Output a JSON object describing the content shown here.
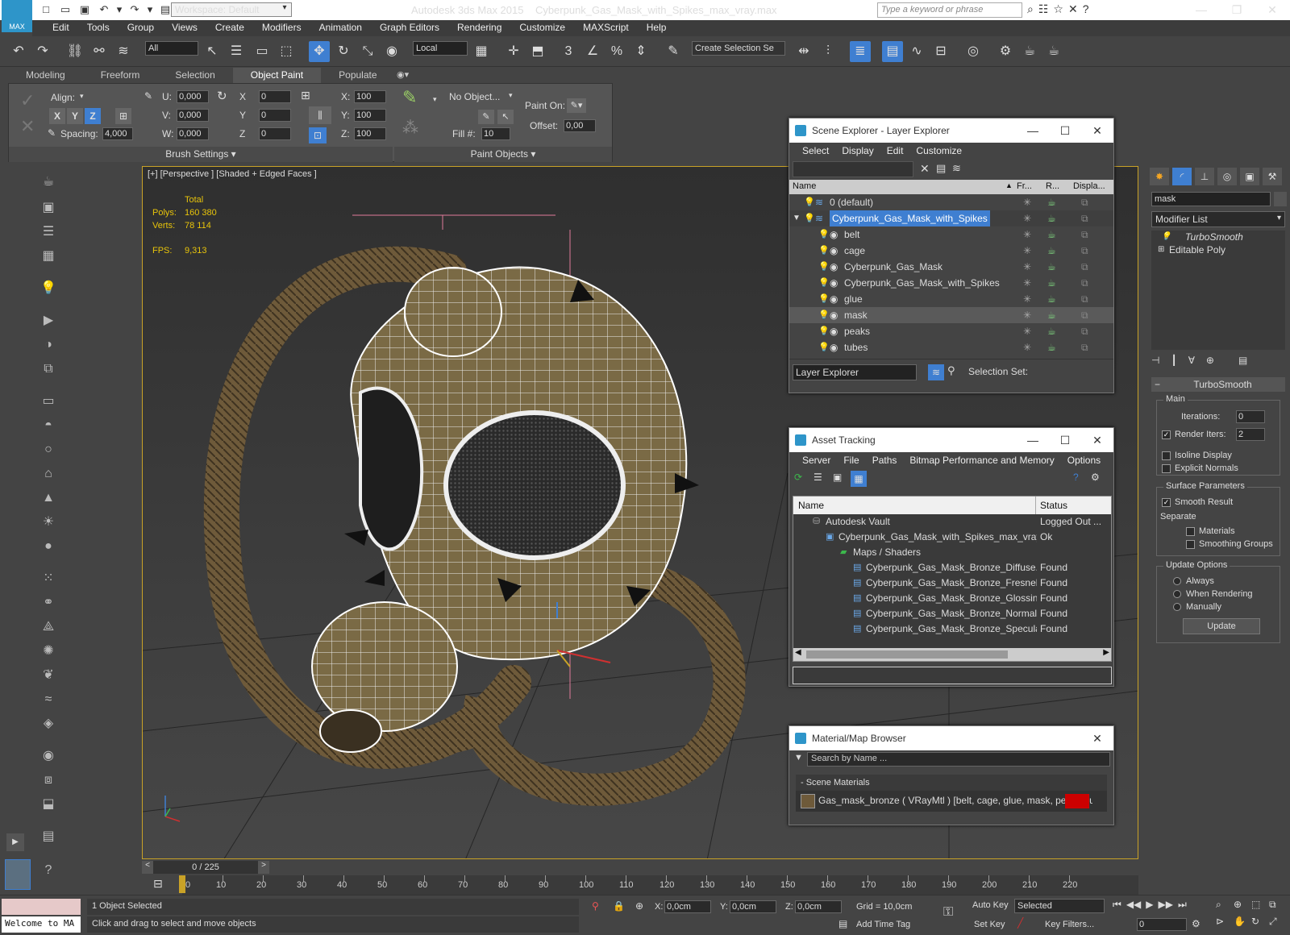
{
  "app": {
    "title": "Autodesk 3ds Max  2015",
    "file": "Cyberpunk_Gas_Mask_with_Spikes_max_vray.max",
    "logo": "MAX",
    "workspace": "Workspace: Default",
    "keyword_placeholder": "Type a keyword or phrase"
  },
  "menu": [
    "Edit",
    "Tools",
    "Group",
    "Views",
    "Create",
    "Modifiers",
    "Animation",
    "Graph Editors",
    "Rendering",
    "Customize",
    "MAXScript",
    "Help"
  ],
  "toolbar": {
    "filter": "All",
    "ref_coord": "Local",
    "selection_set": "Create Selection Se"
  },
  "ribbon": {
    "tabs": [
      "Modeling",
      "Freeform",
      "Selection",
      "Object Paint",
      "Populate"
    ],
    "active_tab": "Object Paint",
    "align": "Align:",
    "axes": [
      "X",
      "Y",
      "Z"
    ],
    "spacing_label": "Spacing:",
    "spacing": "4,000",
    "u_label": "U:",
    "v_label": "V:",
    "w_label": "W:",
    "uvw": [
      "0,000",
      "0,000",
      "0,000"
    ],
    "xyz_labels": [
      "X",
      "Y",
      "Z"
    ],
    "xyz": [
      "0",
      "0",
      "0"
    ],
    "scale_labels": [
      "X:",
      "Y:",
      "Z:"
    ],
    "scale": [
      "100",
      "100",
      "100"
    ],
    "no_object": "No Object...",
    "fill_label": "Fill #:",
    "fill": "10",
    "paint_on": "Paint On:",
    "offset_label": "Offset:",
    "offset": "0,00",
    "brush_settings": "Brush Settings",
    "paint_objects": "Paint Objects"
  },
  "viewport": {
    "label": "[+] [Perspective ] [Shaded + Edged Faces ]",
    "total": "Total",
    "polys_label": "Polys:",
    "polys": "160 380",
    "verts_label": "Verts:",
    "verts": "78 114",
    "fps_label": "FPS:",
    "fps": "9,313"
  },
  "scene_explorer": {
    "title": "Scene Explorer - Layer Explorer",
    "menu": [
      "Select",
      "Display",
      "Edit",
      "Customize"
    ],
    "cols": [
      "Name",
      "Fr...",
      "R...",
      "Displa..."
    ],
    "rows": [
      {
        "name": "0 (default)",
        "level": 0
      },
      {
        "name": "Cyberpunk_Gas_Mask_with_Spikes",
        "level": 0,
        "selected": true
      },
      {
        "name": "belt",
        "level": 1
      },
      {
        "name": "cage",
        "level": 1
      },
      {
        "name": "Cyberpunk_Gas_Mask",
        "level": 1
      },
      {
        "name": "Cyberpunk_Gas_Mask_with_Spikes",
        "level": 1
      },
      {
        "name": "glue",
        "level": 1
      },
      {
        "name": "mask",
        "level": 1,
        "highlight": true
      },
      {
        "name": "peaks",
        "level": 1
      },
      {
        "name": "tubes",
        "level": 1
      }
    ],
    "footer_combo": "Layer Explorer",
    "selection_set": "Selection Set:"
  },
  "asset_tracking": {
    "title": "Asset Tracking",
    "menu": [
      "Server",
      "File",
      "Paths",
      "Bitmap Performance and Memory",
      "Options"
    ],
    "cols": [
      "Name",
      "Status"
    ],
    "rows": [
      {
        "name": "Autodesk Vault",
        "status": "Logged Out ...",
        "level": 0
      },
      {
        "name": "Cyberpunk_Gas_Mask_with_Spikes_max_vray...",
        "status": "Ok",
        "level": 1
      },
      {
        "name": "Maps / Shaders",
        "status": "",
        "level": 2
      },
      {
        "name": "Cyberpunk_Gas_Mask_Bronze_Diffuse....",
        "status": "Found",
        "level": 3
      },
      {
        "name": "Cyberpunk_Gas_Mask_Bronze_Fresnel....",
        "status": "Found",
        "level": 3
      },
      {
        "name": "Cyberpunk_Gas_Mask_Bronze_Glossine....",
        "status": "Found",
        "level": 3
      },
      {
        "name": "Cyberpunk_Gas_Mask_Bronze_Normal....",
        "status": "Found",
        "level": 3
      },
      {
        "name": "Cyberpunk_Gas_Mask_Bronze_Specular...",
        "status": "Found",
        "level": 3
      }
    ]
  },
  "material_browser": {
    "title": "Material/Map Browser",
    "search": "Search by Name ...",
    "section": "- Scene Materials",
    "material": "Gas_mask_bronze  ( VRayMtl )  [belt, cage, glue, mask, peaks, tub..."
  },
  "command_panel": {
    "object_name": "mask",
    "modifier_list": "Modifier List",
    "stack": [
      "TurboSmooth",
      "Editable Poly"
    ],
    "rollout": "TurboSmooth",
    "main": "Main",
    "iterations_label": "Iterations:",
    "iterations": "0",
    "render_iters_label": "Render Iters:",
    "render_iters": "2",
    "isoline": "Isoline Display",
    "explicit": "Explicit Normals",
    "surface": "Surface Parameters",
    "smooth_result": "Smooth Result",
    "separate": "Separate",
    "materials": "Materials",
    "smoothing": "Smoothing Groups",
    "update_options": "Update Options",
    "always": "Always",
    "when_rendering": "When Rendering",
    "manually": "Manually",
    "update_btn": "Update"
  },
  "timeline": {
    "frame": "0 / 225",
    "ticks": [
      "0",
      "10",
      "20",
      "30",
      "40",
      "50",
      "60",
      "70",
      "80",
      "90",
      "100",
      "110",
      "120",
      "130",
      "140",
      "150",
      "160",
      "170",
      "180",
      "190",
      "200",
      "210",
      "220"
    ]
  },
  "status": {
    "welcome": "Welcome to MA",
    "selected": "1 Object Selected",
    "hint": "Click and drag to select and move objects",
    "x_label": "X:",
    "x": "0,0cm",
    "y_label": "Y:",
    "y": "0,0cm",
    "z_label": "Z:",
    "z": "0,0cm",
    "grid": "Grid = 10,0cm",
    "add_time_tag": "Add Time Tag",
    "auto_key": "Auto Key",
    "set_key": "Set Key",
    "key_mode": "Selected",
    "key_filters": "Key Filters...",
    "frame": "0"
  },
  "colors": {
    "accent": "#3f7fd1",
    "viewport_border": "#c9a227",
    "stats": "#e8c40a"
  }
}
